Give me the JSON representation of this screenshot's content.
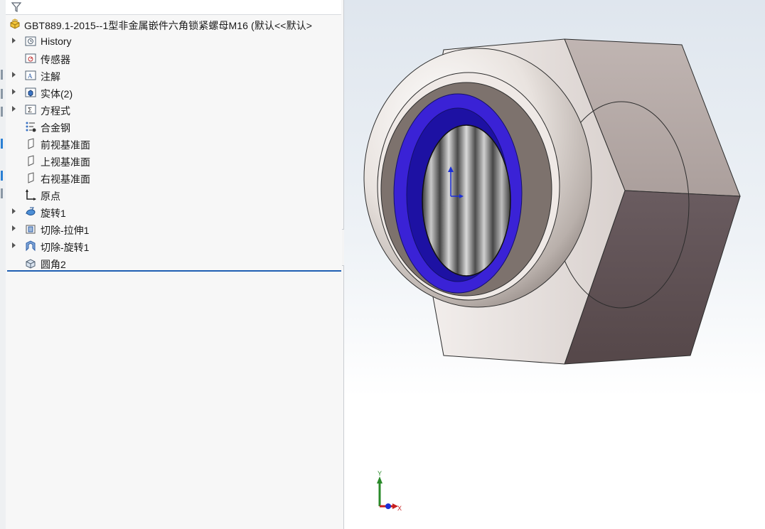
{
  "part": {
    "name": "GBT889.1-2015--1型非金属嵌件六角锁紧螺母M16 (默认<<默认>"
  },
  "tree": {
    "items": [
      {
        "label": "History",
        "icon": "history-folder-icon",
        "expandable": true
      },
      {
        "label": "传感器",
        "icon": "sensor-folder-icon",
        "expandable": false
      },
      {
        "label": "注解",
        "icon": "annotation-folder-icon",
        "expandable": true
      },
      {
        "label": "实体(2)",
        "icon": "solid-bodies-folder-icon",
        "expandable": true
      },
      {
        "label": "方程式",
        "icon": "equations-folder-icon",
        "expandable": true
      },
      {
        "label": "合金钢",
        "icon": "material-icon",
        "expandable": false
      },
      {
        "label": "前视基准面",
        "icon": "plane-icon",
        "expandable": false
      },
      {
        "label": "上视基准面",
        "icon": "plane-icon",
        "expandable": false
      },
      {
        "label": "右视基准面",
        "icon": "plane-icon",
        "expandable": false
      },
      {
        "label": "原点",
        "icon": "origin-icon",
        "expandable": false
      },
      {
        "label": "旋转1",
        "icon": "revolve-feature-icon",
        "expandable": true
      },
      {
        "label": "切除-拉伸1",
        "icon": "extrude-cut-icon",
        "expandable": true
      },
      {
        "label": "切除-旋转1",
        "icon": "revolve-cut-icon",
        "expandable": true
      },
      {
        "label": "圆角2",
        "icon": "fillet-icon",
        "expandable": false
      }
    ]
  },
  "triad": {
    "x_label": "X",
    "y_label": "Y"
  },
  "colors": {
    "nylon_insert": "#3a22d6",
    "hex_face_light": "#b7aca9",
    "hex_face_dark": "#5d4f53",
    "rollback_bar": "#1f5fb3"
  }
}
